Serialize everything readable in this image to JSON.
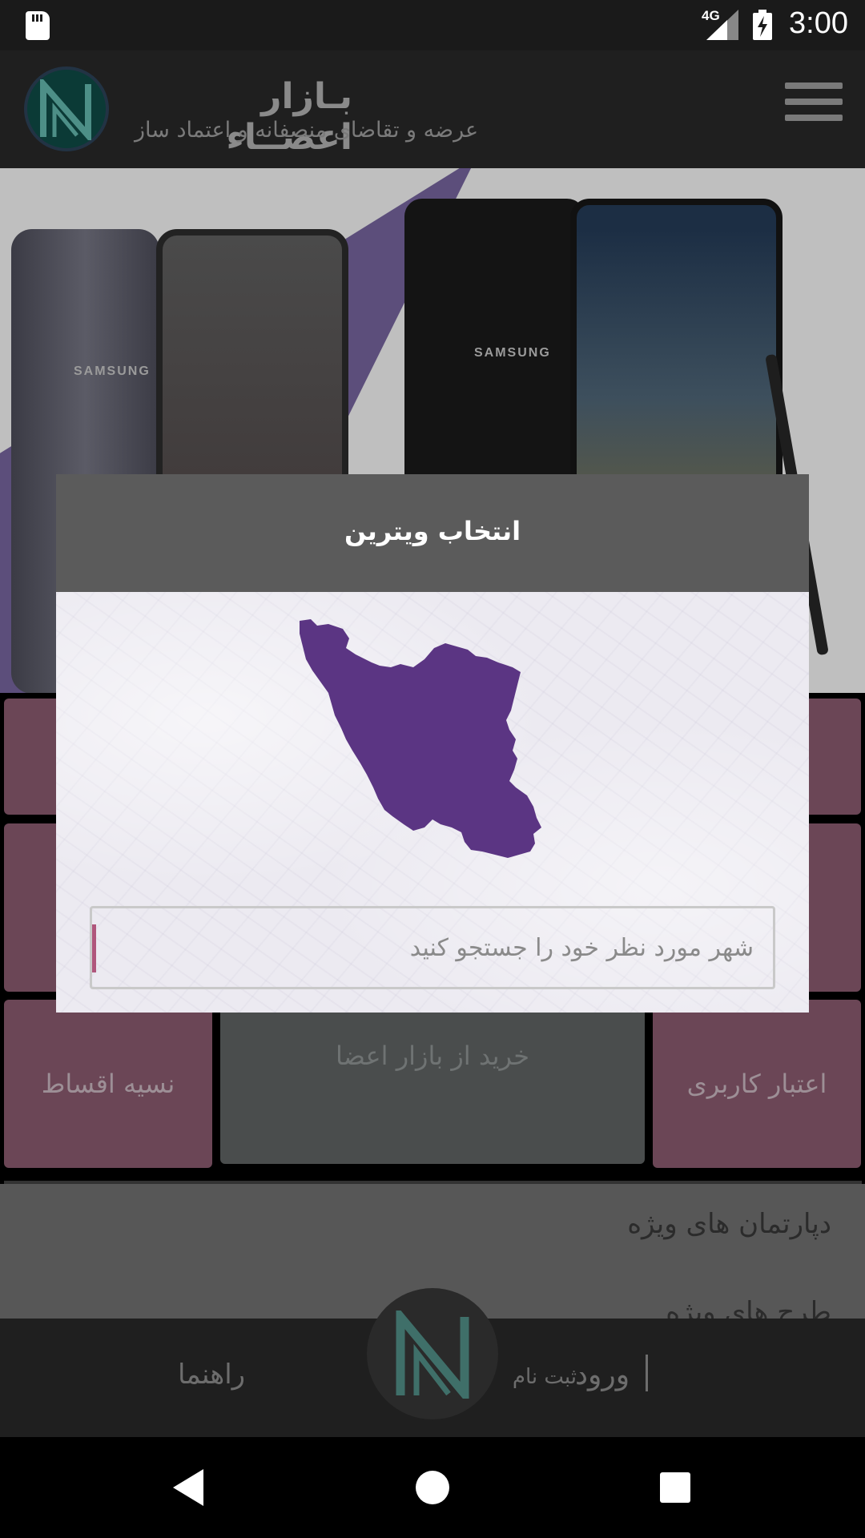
{
  "status_bar": {
    "network": "4G",
    "time": "3:00"
  },
  "header": {
    "brand_title": "بـازار اعضــاء",
    "brand_subtitle": "عرضه و تقاضای منصفانه و اعتماد ساز",
    "menu_icon": "hamburger-menu-icon"
  },
  "banner": {
    "brand_mark_1": "SAMSUNG",
    "brand_mark_2": "SAMSUNG"
  },
  "tiles": {
    "installments": "نسیه اقساط",
    "buy_from_market": "خرید از بازار اعضا",
    "user_credit": "اعتبار کاربری"
  },
  "list": {
    "item_1": "دپارتمان های ویژه",
    "item_2": "طرح های ویژه"
  },
  "bottom_bar": {
    "guide": "راهنما",
    "login": "ورود",
    "register": "ثبت نام"
  },
  "dialog": {
    "title": "انتخاب ویترین",
    "map_color": "#5b3583",
    "search_placeholder": "شهر مورد نظر خود را جستجو کنید",
    "search_value": ""
  },
  "colors": {
    "accent": "#b0567c",
    "tile": "#6b4656",
    "header": "#1f1f1f"
  }
}
